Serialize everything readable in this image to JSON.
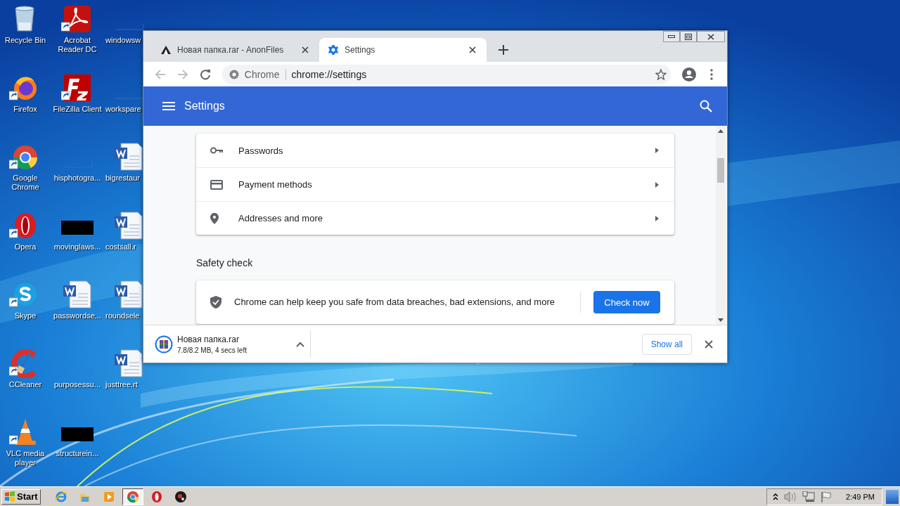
{
  "desktop": {
    "icons": [
      {
        "label": "Recycle Bin",
        "kind": "recycle",
        "shortcut": false
      },
      {
        "label": "Firefox",
        "kind": "firefox",
        "shortcut": true
      },
      {
        "label": "Google Chrome",
        "kind": "chrome",
        "shortcut": true
      },
      {
        "label": "Opera",
        "kind": "opera",
        "shortcut": true
      },
      {
        "label": "Skype",
        "kind": "skype",
        "shortcut": true
      },
      {
        "label": "CCleaner",
        "kind": "ccleaner",
        "shortcut": true
      },
      {
        "label": "VLC media player",
        "kind": "vlc",
        "shortcut": true
      },
      {
        "label": "Acrobat Reader DC",
        "kind": "acrobat",
        "shortcut": true
      },
      {
        "label": "FileZilla Client",
        "kind": "filezilla",
        "shortcut": true
      },
      {
        "label": "hisphotogra...",
        "kind": "blank",
        "shortcut": false
      },
      {
        "label": "movinglaws...",
        "kind": "black",
        "shortcut": false
      },
      {
        "label": "passwordse...",
        "kind": "word",
        "shortcut": false
      },
      {
        "label": "purposessu...",
        "kind": "blank",
        "shortcut": false
      },
      {
        "label": "structurein...",
        "kind": "black",
        "shortcut": false
      },
      {
        "label": "windowsw",
        "kind": "blank",
        "shortcut": false
      },
      {
        "label": "workspare",
        "kind": "blank",
        "shortcut": false
      },
      {
        "label": "bigrestaur",
        "kind": "word",
        "shortcut": false
      },
      {
        "label": "costsall.r",
        "kind": "word",
        "shortcut": false
      },
      {
        "label": "roundsele",
        "kind": "word",
        "shortcut": false
      },
      {
        "label": "justtree.rt",
        "kind": "word",
        "shortcut": false
      }
    ]
  },
  "browser": {
    "tabs": [
      {
        "label": "Новая папка.rar - AnonFiles",
        "kind": "site",
        "selected": false
      },
      {
        "label": "Settings",
        "kind": "settings",
        "selected": true
      }
    ],
    "address": {
      "site_label": "Chrome",
      "url": "chrome://settings"
    },
    "header": {
      "title": "Settings"
    },
    "autofill_rows": [
      {
        "label": "Passwords",
        "kind": "key"
      },
      {
        "label": "Payment methods",
        "kind": "card"
      },
      {
        "label": "Addresses and more",
        "kind": "pin"
      }
    ],
    "safety_check": {
      "heading": "Safety check",
      "description": "Chrome can help keep you safe from data breaches, bad extensions, and more",
      "button": "Check now"
    },
    "download": {
      "filename": "Новая папка.rar",
      "status": "7.8/8.2 MB, 4 secs left",
      "show_all": "Show all"
    }
  },
  "taskbar": {
    "start": "Start",
    "apps": [
      {
        "kind": "ie",
        "selected": false
      },
      {
        "kind": "folder",
        "selected": false
      },
      {
        "kind": "media",
        "selected": false
      },
      {
        "kind": "chrome",
        "selected": true
      },
      {
        "kind": "opera",
        "selected": false
      },
      {
        "kind": "dark",
        "selected": false
      }
    ],
    "clock": "2:49 PM"
  }
}
